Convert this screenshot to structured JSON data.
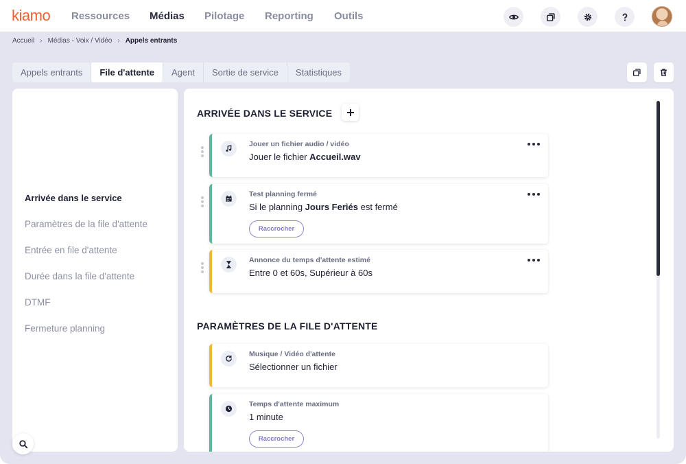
{
  "app": {
    "logo": "kiamo"
  },
  "nav": {
    "items": [
      {
        "label": "Ressources"
      },
      {
        "label": "Médias"
      },
      {
        "label": "Pilotage"
      },
      {
        "label": "Reporting"
      },
      {
        "label": "Outils"
      }
    ],
    "active": "Médias",
    "icons": [
      "eye-icon",
      "window-icon",
      "gear-icon",
      "help-icon"
    ]
  },
  "breadcrumb": {
    "items": [
      "Accueil",
      "Médias - Voix / Vidéo",
      "Appels entrants"
    ],
    "separator": "›"
  },
  "tabs": {
    "items": [
      {
        "label": "Appels entrants"
      },
      {
        "label": "File d'attente"
      },
      {
        "label": "Agent"
      },
      {
        "label": "Sortie de service"
      },
      {
        "label": "Statistiques"
      }
    ],
    "active": "File d'attente"
  },
  "sidebar": {
    "items": [
      {
        "label": "Arrivée dans le service"
      },
      {
        "label": "Paramètres de la file d'attente"
      },
      {
        "label": "Entrée en file d'attente"
      },
      {
        "label": "Durée dans la file d'attente"
      },
      {
        "label": "DTMF"
      },
      {
        "label": "Fermeture planning"
      }
    ],
    "active": "Arrivée dans le service"
  },
  "sections": {
    "arrival": {
      "title": "ARRIVÉE DANS LE SERVICE",
      "cards": [
        {
          "icon": "music-note-icon",
          "accent": "#5cb89c",
          "title": "Jouer un fichier audio / vidéo",
          "text_prefix": "Jouer le fichier ",
          "text_bold": "Accueil.wav",
          "text_suffix": ""
        },
        {
          "icon": "calendar-icon",
          "accent": "#5cb89c",
          "title": "Test planning fermé",
          "text_prefix": "Si le planning ",
          "text_bold": "Jours Feriés",
          "text_suffix": " est fermé",
          "button": "Raccrocher"
        },
        {
          "icon": "hourglass-icon",
          "accent": "#f3b534",
          "title": "Annonce du temps d'attente estimé",
          "text": "Entre 0 et 60s, Supérieur à 60s"
        }
      ]
    },
    "queue": {
      "title": "PARAMÈTRES DE LA FILE D'ATTENTE",
      "cards": [
        {
          "icon": "refresh-icon",
          "accent": "#f3b534",
          "title": "Musique / Vidéo d'attente",
          "text": "Sélectionner un fichier"
        },
        {
          "icon": "clock-icon",
          "accent": "#5cb89c",
          "title": "Temps d'attente maximum",
          "text": "1 minute",
          "button": "Raccrocher"
        }
      ]
    }
  },
  "colors": {
    "brand": "#f0602f",
    "teal_accent": "#5cb89c",
    "yellow_accent": "#f3b534",
    "button_purple": "#8179cc"
  }
}
